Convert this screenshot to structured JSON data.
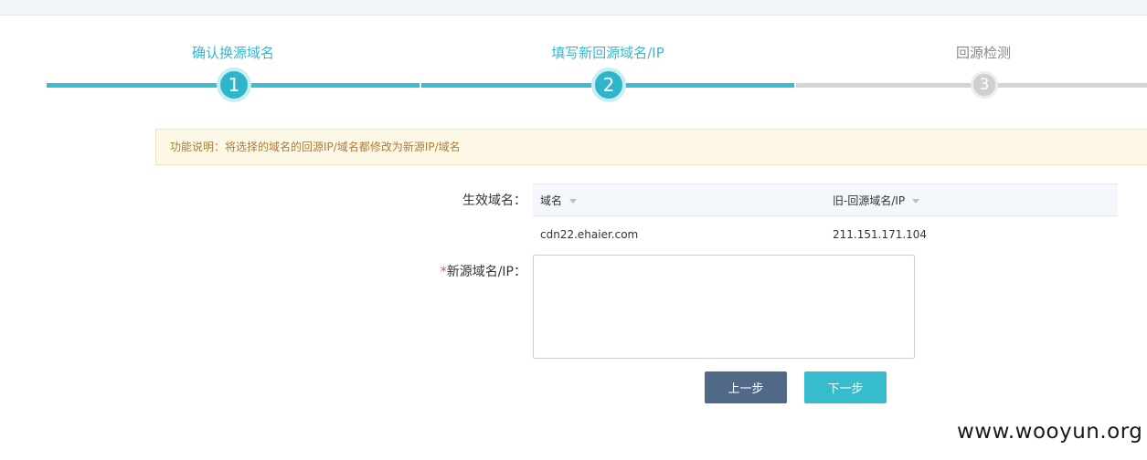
{
  "steps": [
    {
      "label": "确认换源域名",
      "number": "1",
      "state": "active"
    },
    {
      "label": "填写新回源域名/IP",
      "number": "2",
      "state": "active"
    },
    {
      "label": "回源检测",
      "number": "3",
      "state": "inactive"
    }
  ],
  "notice": {
    "text": "功能说明：将选择的域名的回源IP/域名都修改为新源IP/域名"
  },
  "form": {
    "effective_domain_label": "生效域名：",
    "new_source_required_mark": "*",
    "new_source_label": "新源域名/IP：",
    "new_source_value": ""
  },
  "table": {
    "columns": [
      "域名",
      "旧-回源域名/IP"
    ],
    "rows": [
      {
        "domain": "cdn22.ehaier.com",
        "old_source": "211.151.171.104"
      }
    ]
  },
  "buttons": {
    "prev": "上一步",
    "next": "下一步"
  },
  "watermark": "www.wooyun.org",
  "colors": {
    "accent": "#36b9cd",
    "prev_button": "#4f6987",
    "notice_bg": "#fdf9e6",
    "notice_text": "#b0793a"
  }
}
